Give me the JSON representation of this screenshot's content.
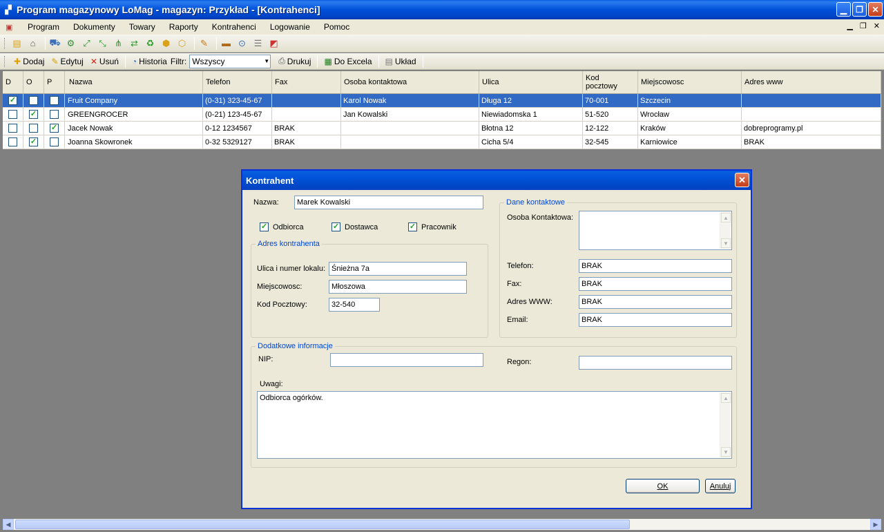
{
  "window": {
    "title": "Program magazynowy LoMag - magazyn: Przykład - [Kontrahenci]"
  },
  "menu": [
    "Program",
    "Dokumenty",
    "Towary",
    "Raporty",
    "Kontrahenci",
    "Logowanie",
    "Pomoc"
  ],
  "toolbar2": {
    "add": "Dodaj",
    "edit": "Edytuj",
    "delete": "Usuń",
    "history": "Historia",
    "filter_label": "Filtr:",
    "filter_value": "Wszyscy",
    "print": "Drukuj",
    "excel": "Do Excela",
    "layout": "Układ"
  },
  "grid": {
    "headers": [
      "D",
      "O",
      "P",
      "Nazwa",
      "Telefon",
      "Fax",
      "Osoba kontaktowa",
      "Ulica",
      "Kod pocztowy",
      "Miejscowosc",
      "Adres www"
    ],
    "rows": [
      {
        "d": true,
        "o": false,
        "p": false,
        "nazwa": "Fruit Company",
        "telefon": "(0-31) 323-45-67",
        "fax": "",
        "osoba": "Karol Nowak",
        "ulica": "Długa 12",
        "kod": "70-001",
        "miejscowosc": "Szczecin",
        "www": "",
        "selected": true
      },
      {
        "d": false,
        "o": true,
        "p": false,
        "nazwa": "GREENGROCER",
        "telefon": "(0-21) 123-45-67",
        "fax": "",
        "osoba": "Jan Kowalski",
        "ulica": "Niewiadomska 1",
        "kod": "51-520",
        "miejscowosc": "Wrocław",
        "www": ""
      },
      {
        "d": false,
        "o": false,
        "p": true,
        "nazwa": "Jacek Nowak",
        "telefon": "0-12 1234567",
        "fax": "BRAK",
        "osoba": "",
        "ulica": "Błotna 12",
        "kod": "12-122",
        "miejscowosc": "Kraków",
        "www": "dobreprogramy.pl"
      },
      {
        "d": false,
        "o": true,
        "p": false,
        "nazwa": "Joanna Skowronek",
        "telefon": "0-32 5329127",
        "fax": "BRAK",
        "osoba": "",
        "ulica": "Cicha 5/4",
        "kod": "32-545",
        "miejscowosc": "Karniowice",
        "www": "BRAK"
      }
    ]
  },
  "dialog": {
    "title": "Kontrahent",
    "nazwa_label": "Nazwa:",
    "nazwa_value": "Marek Kowalski",
    "odbiorca": "Odbiorca",
    "dostawca": "Dostawca",
    "pracownik": "Pracownik",
    "adres_group": "Adres kontrahenta",
    "ulica_label": "Ulica i numer lokalu:",
    "ulica_value": "Śnieżna 7a",
    "miejscowosc_label": "Miejscowosc:",
    "miejscowosc_value": "Młoszowa",
    "kod_label": "Kod Pocztowy:",
    "kod_value": "32-540",
    "kontakt_group": "Dane kontaktowe",
    "osoba_label": "Osoba Kontaktowa:",
    "osoba_value": "",
    "telefon_label": "Telefon:",
    "telefon_value": "BRAK",
    "fax_label": "Fax:",
    "fax_value": "BRAK",
    "www_label": "Adres WWW:",
    "www_value": "BRAK",
    "email_label": "Email:",
    "email_value": "BRAK",
    "dodatkowe_group": "Dodatkowe informacje",
    "nip_label": "NIP:",
    "nip_value": "",
    "regon_label": "Regon:",
    "regon_value": "",
    "uwagi_label": "Uwagi:",
    "uwagi_value": "Odbiorca ogórków.",
    "ok": "OK",
    "cancel": "Anuluj"
  }
}
